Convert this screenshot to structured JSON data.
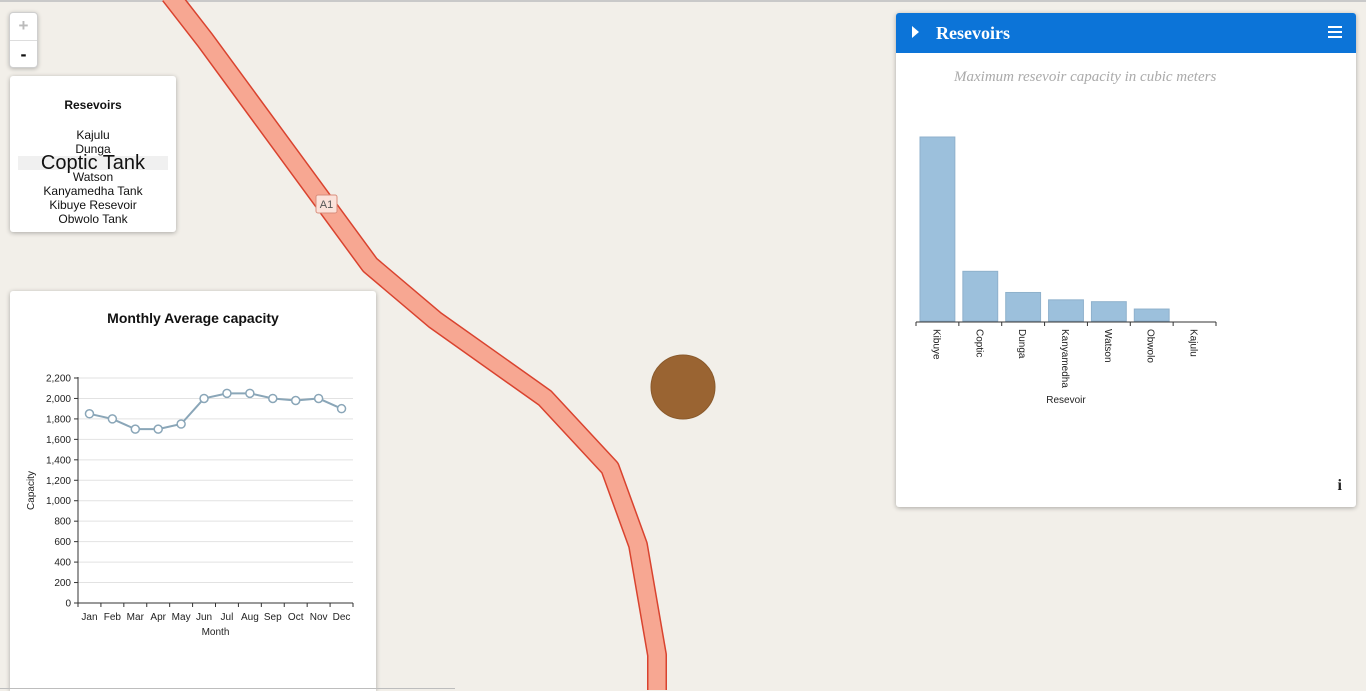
{
  "map": {
    "road_label": "A1",
    "colors": {
      "road_fill": "#f7a792",
      "road_stroke": "#d9432f",
      "marker": "#9a6432",
      "background": "#f2efe9"
    }
  },
  "zoom": {
    "in_label": "+",
    "out_label": "-"
  },
  "reservoir_list": {
    "title": "Resevoirs",
    "items": [
      "Kajulu",
      "Dunga",
      "Coptic Tank",
      "Watson",
      "Kanyamedha Tank",
      "Kibuye Resevoir",
      "Obwolo Tank"
    ],
    "active": "Coptic Tank"
  },
  "line_chart": {
    "title": "Monthly Average capacity",
    "chart_data": {
      "type": "line",
      "title": "Monthly Average capacity",
      "xlabel": "Month",
      "ylabel": "Capacity",
      "categories": [
        "Jan",
        "Feb",
        "Mar",
        "Apr",
        "May",
        "Jun",
        "Jul",
        "Aug",
        "Sep",
        "Oct",
        "Nov",
        "Dec"
      ],
      "values": [
        1850,
        1800,
        1700,
        1700,
        1750,
        2000,
        2050,
        2050,
        2000,
        1980,
        2000,
        1900
      ],
      "ylim": [
        0,
        2200
      ],
      "yticks": [
        "0",
        "200",
        "400",
        "600",
        "800",
        "1,000",
        "1,200",
        "1,400",
        "1,600",
        "1,800",
        "2,000",
        "2,200"
      ],
      "grid": true,
      "color": "#8aa6b8"
    }
  },
  "bar_chart": {
    "header_title": "Resevoirs",
    "subtitle": "Maximum resevoir capacity in cubic meters",
    "chart_data": {
      "type": "bar",
      "xlabel": "Resevoir",
      "categories": [
        "Kibuye",
        "Coptic",
        "Dunga",
        "Kanyamedha",
        "Watson",
        "Obwolo",
        "Kajulu"
      ],
      "values": [
        100,
        27,
        15.5,
        11.5,
        10.5,
        6.5,
        0
      ],
      "ylim": [
        0,
        100
      ],
      "color": "#9cc0dc"
    }
  }
}
